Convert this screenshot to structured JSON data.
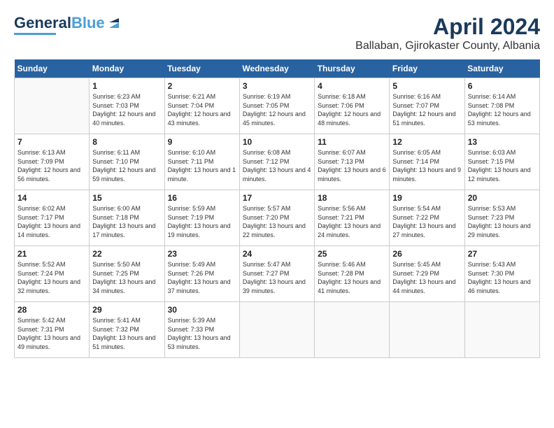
{
  "header": {
    "logo_general": "General",
    "logo_blue": "Blue",
    "month_title": "April 2024",
    "location": "Ballaban, Gjirokaster County, Albania"
  },
  "days_of_week": [
    "Sunday",
    "Monday",
    "Tuesday",
    "Wednesday",
    "Thursday",
    "Friday",
    "Saturday"
  ],
  "weeks": [
    [
      {
        "day": "",
        "sunrise": "",
        "sunset": "",
        "daylight": ""
      },
      {
        "day": "1",
        "sunrise": "Sunrise: 6:23 AM",
        "sunset": "Sunset: 7:03 PM",
        "daylight": "Daylight: 12 hours and 40 minutes."
      },
      {
        "day": "2",
        "sunrise": "Sunrise: 6:21 AM",
        "sunset": "Sunset: 7:04 PM",
        "daylight": "Daylight: 12 hours and 43 minutes."
      },
      {
        "day": "3",
        "sunrise": "Sunrise: 6:19 AM",
        "sunset": "Sunset: 7:05 PM",
        "daylight": "Daylight: 12 hours and 45 minutes."
      },
      {
        "day": "4",
        "sunrise": "Sunrise: 6:18 AM",
        "sunset": "Sunset: 7:06 PM",
        "daylight": "Daylight: 12 hours and 48 minutes."
      },
      {
        "day": "5",
        "sunrise": "Sunrise: 6:16 AM",
        "sunset": "Sunset: 7:07 PM",
        "daylight": "Daylight: 12 hours and 51 minutes."
      },
      {
        "day": "6",
        "sunrise": "Sunrise: 6:14 AM",
        "sunset": "Sunset: 7:08 PM",
        "daylight": "Daylight: 12 hours and 53 minutes."
      }
    ],
    [
      {
        "day": "7",
        "sunrise": "Sunrise: 6:13 AM",
        "sunset": "Sunset: 7:09 PM",
        "daylight": "Daylight: 12 hours and 56 minutes."
      },
      {
        "day": "8",
        "sunrise": "Sunrise: 6:11 AM",
        "sunset": "Sunset: 7:10 PM",
        "daylight": "Daylight: 12 hours and 59 minutes."
      },
      {
        "day": "9",
        "sunrise": "Sunrise: 6:10 AM",
        "sunset": "Sunset: 7:11 PM",
        "daylight": "Daylight: 13 hours and 1 minute."
      },
      {
        "day": "10",
        "sunrise": "Sunrise: 6:08 AM",
        "sunset": "Sunset: 7:12 PM",
        "daylight": "Daylight: 13 hours and 4 minutes."
      },
      {
        "day": "11",
        "sunrise": "Sunrise: 6:07 AM",
        "sunset": "Sunset: 7:13 PM",
        "daylight": "Daylight: 13 hours and 6 minutes."
      },
      {
        "day": "12",
        "sunrise": "Sunrise: 6:05 AM",
        "sunset": "Sunset: 7:14 PM",
        "daylight": "Daylight: 13 hours and 9 minutes."
      },
      {
        "day": "13",
        "sunrise": "Sunrise: 6:03 AM",
        "sunset": "Sunset: 7:15 PM",
        "daylight": "Daylight: 13 hours and 12 minutes."
      }
    ],
    [
      {
        "day": "14",
        "sunrise": "Sunrise: 6:02 AM",
        "sunset": "Sunset: 7:17 PM",
        "daylight": "Daylight: 13 hours and 14 minutes."
      },
      {
        "day": "15",
        "sunrise": "Sunrise: 6:00 AM",
        "sunset": "Sunset: 7:18 PM",
        "daylight": "Daylight: 13 hours and 17 minutes."
      },
      {
        "day": "16",
        "sunrise": "Sunrise: 5:59 AM",
        "sunset": "Sunset: 7:19 PM",
        "daylight": "Daylight: 13 hours and 19 minutes."
      },
      {
        "day": "17",
        "sunrise": "Sunrise: 5:57 AM",
        "sunset": "Sunset: 7:20 PM",
        "daylight": "Daylight: 13 hours and 22 minutes."
      },
      {
        "day": "18",
        "sunrise": "Sunrise: 5:56 AM",
        "sunset": "Sunset: 7:21 PM",
        "daylight": "Daylight: 13 hours and 24 minutes."
      },
      {
        "day": "19",
        "sunrise": "Sunrise: 5:54 AM",
        "sunset": "Sunset: 7:22 PM",
        "daylight": "Daylight: 13 hours and 27 minutes."
      },
      {
        "day": "20",
        "sunrise": "Sunrise: 5:53 AM",
        "sunset": "Sunset: 7:23 PM",
        "daylight": "Daylight: 13 hours and 29 minutes."
      }
    ],
    [
      {
        "day": "21",
        "sunrise": "Sunrise: 5:52 AM",
        "sunset": "Sunset: 7:24 PM",
        "daylight": "Daylight: 13 hours and 32 minutes."
      },
      {
        "day": "22",
        "sunrise": "Sunrise: 5:50 AM",
        "sunset": "Sunset: 7:25 PM",
        "daylight": "Daylight: 13 hours and 34 minutes."
      },
      {
        "day": "23",
        "sunrise": "Sunrise: 5:49 AM",
        "sunset": "Sunset: 7:26 PM",
        "daylight": "Daylight: 13 hours and 37 minutes."
      },
      {
        "day": "24",
        "sunrise": "Sunrise: 5:47 AM",
        "sunset": "Sunset: 7:27 PM",
        "daylight": "Daylight: 13 hours and 39 minutes."
      },
      {
        "day": "25",
        "sunrise": "Sunrise: 5:46 AM",
        "sunset": "Sunset: 7:28 PM",
        "daylight": "Daylight: 13 hours and 41 minutes."
      },
      {
        "day": "26",
        "sunrise": "Sunrise: 5:45 AM",
        "sunset": "Sunset: 7:29 PM",
        "daylight": "Daylight: 13 hours and 44 minutes."
      },
      {
        "day": "27",
        "sunrise": "Sunrise: 5:43 AM",
        "sunset": "Sunset: 7:30 PM",
        "daylight": "Daylight: 13 hours and 46 minutes."
      }
    ],
    [
      {
        "day": "28",
        "sunrise": "Sunrise: 5:42 AM",
        "sunset": "Sunset: 7:31 PM",
        "daylight": "Daylight: 13 hours and 49 minutes."
      },
      {
        "day": "29",
        "sunrise": "Sunrise: 5:41 AM",
        "sunset": "Sunset: 7:32 PM",
        "daylight": "Daylight: 13 hours and 51 minutes."
      },
      {
        "day": "30",
        "sunrise": "Sunrise: 5:39 AM",
        "sunset": "Sunset: 7:33 PM",
        "daylight": "Daylight: 13 hours and 53 minutes."
      },
      {
        "day": "",
        "sunrise": "",
        "sunset": "",
        "daylight": ""
      },
      {
        "day": "",
        "sunrise": "",
        "sunset": "",
        "daylight": ""
      },
      {
        "day": "",
        "sunrise": "",
        "sunset": "",
        "daylight": ""
      },
      {
        "day": "",
        "sunrise": "",
        "sunset": "",
        "daylight": ""
      }
    ]
  ]
}
